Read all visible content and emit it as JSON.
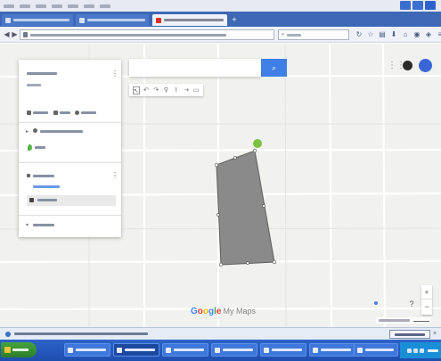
{
  "browser": {
    "menu_items": [
      "",
      "",
      "",
      "",
      "",
      "",
      ""
    ],
    "tabs": [
      {
        "label": "",
        "active": false
      },
      {
        "label": "",
        "active": false
      },
      {
        "label": "",
        "active": true
      }
    ],
    "new_tab_label": "+",
    "address_value": "",
    "search_value": ""
  },
  "map": {
    "search": {
      "placeholder": "",
      "button_icon": "search-icon"
    },
    "drawing_tools": [
      "hand-icon",
      "undo-icon",
      "redo-icon",
      "marker-icon",
      "polygon-icon",
      "route-icon",
      "ruler-icon"
    ],
    "panel": {
      "title": "",
      "subtitle": "",
      "actions": [
        "",
        "",
        ""
      ],
      "layer_title": "",
      "layer_item": "",
      "basemap_label": ""
    },
    "road_labels": [],
    "logo_text": "Google",
    "logo_suffix": "My Maps",
    "polygon_color": "#8a8a8a",
    "polygon_outline": "#5f5f5f",
    "marker_color": "#7cc242",
    "zoom_in": "+",
    "zoom_out": "−",
    "help": "?",
    "scale_text": ""
  },
  "notification": {
    "text": "",
    "button_label": "",
    "close": "×"
  },
  "taskbar": {
    "start_label": "",
    "items": [
      {
        "label": "",
        "active": false
      },
      {
        "label": "",
        "active": true
      },
      {
        "label": "",
        "active": false
      },
      {
        "label": "",
        "active": false
      },
      {
        "label": "",
        "active": false
      },
      {
        "label": "",
        "active": false
      },
      {
        "label": "",
        "active": false
      }
    ],
    "clock": ""
  },
  "colors": {
    "tab_bar": "#3d68b6",
    "accent_blue": "#3f7fe6",
    "taskbar": "#2457bd",
    "start_green": "#3a9436"
  }
}
